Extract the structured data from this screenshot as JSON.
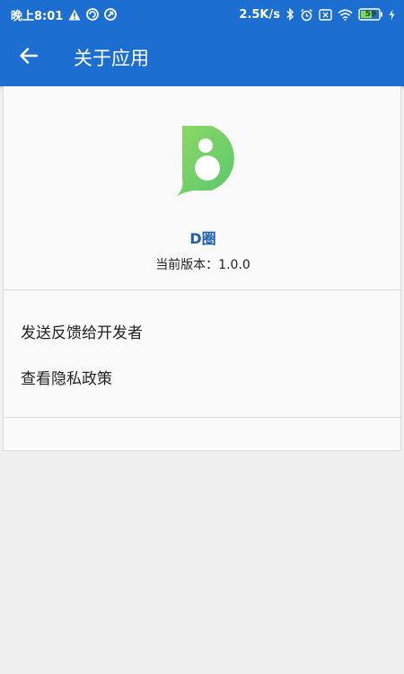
{
  "status_bar": {
    "time": "晚上8:01",
    "network_speed": "2.5K/s",
    "battery_level": "59",
    "left_icons": [
      "warning-icon",
      "sync-icon",
      "refresh-icon"
    ],
    "right_icons": [
      "bluetooth-icon",
      "alarm-icon",
      "no-sim-icon",
      "wifi-icon",
      "battery-icon",
      "charging-icon"
    ]
  },
  "app_bar": {
    "title": "关于应用",
    "back_icon": "arrow-left-icon"
  },
  "about": {
    "app_name": "D圈",
    "version_text": "当前版本：1.0.0",
    "logo_colors": [
      "#8ed864",
      "#5ac86c"
    ]
  },
  "menu": {
    "items": [
      {
        "label": "发送反馈给开发者"
      },
      {
        "label": "查看隐私政策"
      }
    ]
  },
  "colors": {
    "primary": "#1c6fd0",
    "background": "#f0f0f0",
    "card": "#fafafa",
    "app_name": "#1f5fa8"
  }
}
